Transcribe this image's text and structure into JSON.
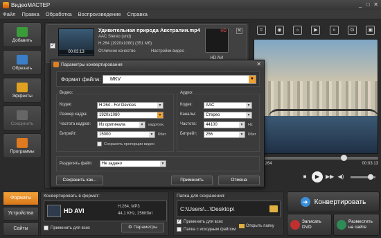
{
  "app": {
    "title": "ВидеоМАСТЕР",
    "window_controls": [
      "_",
      "□",
      "✕"
    ]
  },
  "menu": [
    "Файл",
    "Правка",
    "Обработка",
    "Воспроизведение",
    "Справка"
  ],
  "sidebar": [
    {
      "label": "Добавить",
      "icon": "add-icon",
      "color": "#3a9b3a"
    },
    {
      "label": "Обрезать",
      "icon": "cut-icon",
      "color": "#3a7fc8"
    },
    {
      "label": "Эффекты",
      "icon": "effects-icon",
      "color": "#e0a020"
    },
    {
      "label": "Соединить",
      "icon": "join-icon",
      "color": "#666666",
      "disabled": true
    },
    {
      "label": "Программы",
      "icon": "programs-icon",
      "color": "#e07a20"
    }
  ],
  "file": {
    "name": "Удивительная природа Австралии.mp4",
    "duration": "00:03:13",
    "audio": "AAC Stereo (und)",
    "video": "H.264 (1920x1080) (351 Mб)",
    "quality": "Отличное качество",
    "settings": "Настройки видео",
    "badge": "HD AVI",
    "badge_top": "HD"
  },
  "player": {
    "tools": [
      "crop-icon",
      "snapshot-icon",
      "brightness-icon",
      "video-icon",
      "speed-icon",
      "gif-icon",
      "screen-icon"
    ],
    "time_current": "00:01:264",
    "time_total": "00:03:13",
    "seek_fraction": 0.7,
    "volume_fraction": 0.7
  },
  "bottom_tabs": [
    "Форматы",
    "Устройства",
    "Сайты"
  ],
  "format_panel": {
    "caption": "Конвертировать в формат:",
    "format": "HD AVI",
    "spec1": "H.264, MP3",
    "spec2": "44,1 KHz, 256Кбит",
    "apply_all": "Применить для всех",
    "params": "Параметры"
  },
  "save_panel": {
    "caption": "Папка для сохранения:",
    "path": "C:\\Users\\...\\Desktop\\",
    "apply_all": "Применить для всех",
    "source_folder": "Папка с исходным файлом",
    "open_folder": "Открыть папку"
  },
  "actions": {
    "convert": "Конвертировать",
    "dvd": [
      "Записать",
      "DVD"
    ],
    "web": [
      "Разместить",
      "на сайте"
    ]
  },
  "dialog": {
    "title": "Параметры конвертирования",
    "format_label": "Формат файла:",
    "format_value": "MKV",
    "video_group": "Видео:",
    "audio_group": "Аудио:",
    "video": {
      "codec_label": "Кодек:",
      "codec": "H.264 - For Devices",
      "size_label": "Размер кадра:",
      "size": "1920x1080",
      "fps_label": "Частота кадров:",
      "fps": "Из оригинала",
      "fps_unit": "кадр/сек.",
      "bitrate_label": "Битрейт:",
      "bitrate": "15000",
      "bitrate_unit": "Кбит",
      "keep_aspect": "Сохранять пропорции видео"
    },
    "audio": {
      "codec_label": "Кодек:",
      "codec": "AAC",
      "channels_label": "Каналы:",
      "channels": "Стерео",
      "freq_label": "Частота:",
      "freq": "44100",
      "freq_unit": "Hz",
      "bitrate_label": "Битрейт:",
      "bitrate": "256",
      "bitrate_unit": "Кбит"
    },
    "split_label": "Разделять файл:",
    "split_value": "Не задано",
    "save_as": "Сохранить как...",
    "apply": "Применить",
    "cancel": "Отмена"
  }
}
